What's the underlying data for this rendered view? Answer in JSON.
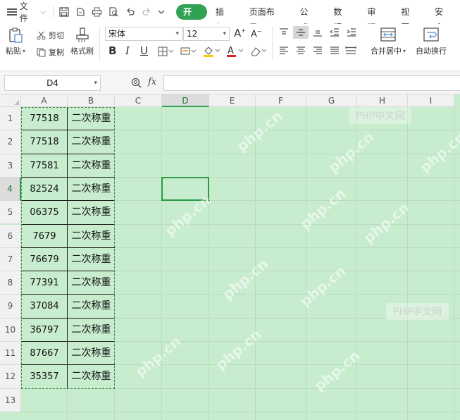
{
  "menu": {
    "file_label": "文件",
    "tabs": [
      {
        "label": "开始",
        "active": true
      },
      {
        "label": "插入",
        "active": false
      },
      {
        "label": "页面布局",
        "active": false
      },
      {
        "label": "公式",
        "active": false
      },
      {
        "label": "数据",
        "active": false
      },
      {
        "label": "审阅",
        "active": false
      },
      {
        "label": "视图",
        "active": false
      },
      {
        "label": "安全",
        "active": false
      }
    ]
  },
  "ribbon": {
    "paste_label": "粘贴",
    "cut_label": "剪切",
    "copy_label": "复制",
    "format_painter_label": "格式刷",
    "font_name": "宋体",
    "font_size": "12",
    "merge_center_label": "合并居中",
    "wrap_text_label": "自动换行"
  },
  "formula_bar": {
    "name_box": "D4",
    "fx_label": "fx",
    "formula_value": ""
  },
  "sheet": {
    "columns": [
      "A",
      "B",
      "C",
      "D",
      "E",
      "F",
      "G",
      "H",
      "I"
    ],
    "rows": [
      "1",
      "2",
      "3",
      "4",
      "5",
      "6",
      "7",
      "8",
      "9",
      "10",
      "11",
      "12",
      "13"
    ],
    "selected_column": "D",
    "selected_row": "4",
    "data": [
      {
        "a": "77518",
        "b": "二次称重"
      },
      {
        "a": "77518",
        "b": "二次称重"
      },
      {
        "a": "77581",
        "b": "二次称重"
      },
      {
        "a": "82524",
        "b": "二次称重"
      },
      {
        "a": "06375",
        "b": "二次称重"
      },
      {
        "a": "7679",
        "b": "二次称重"
      },
      {
        "a": "76679",
        "b": "二次称重"
      },
      {
        "a": "77391",
        "b": "二次称重"
      },
      {
        "a": "37084",
        "b": "二次称重"
      },
      {
        "a": "36797",
        "b": "二次称重"
      },
      {
        "a": "87667",
        "b": "二次称重"
      },
      {
        "a": "35357",
        "b": "二次称重"
      }
    ]
  },
  "watermarks": {
    "php_cn_box": "PHP中文网",
    "php_cn_domain": "php.cn"
  },
  "colors": {
    "accent": "#31a253",
    "sheet_background": "#c8ecce",
    "selection_border": "#2a9a46"
  }
}
